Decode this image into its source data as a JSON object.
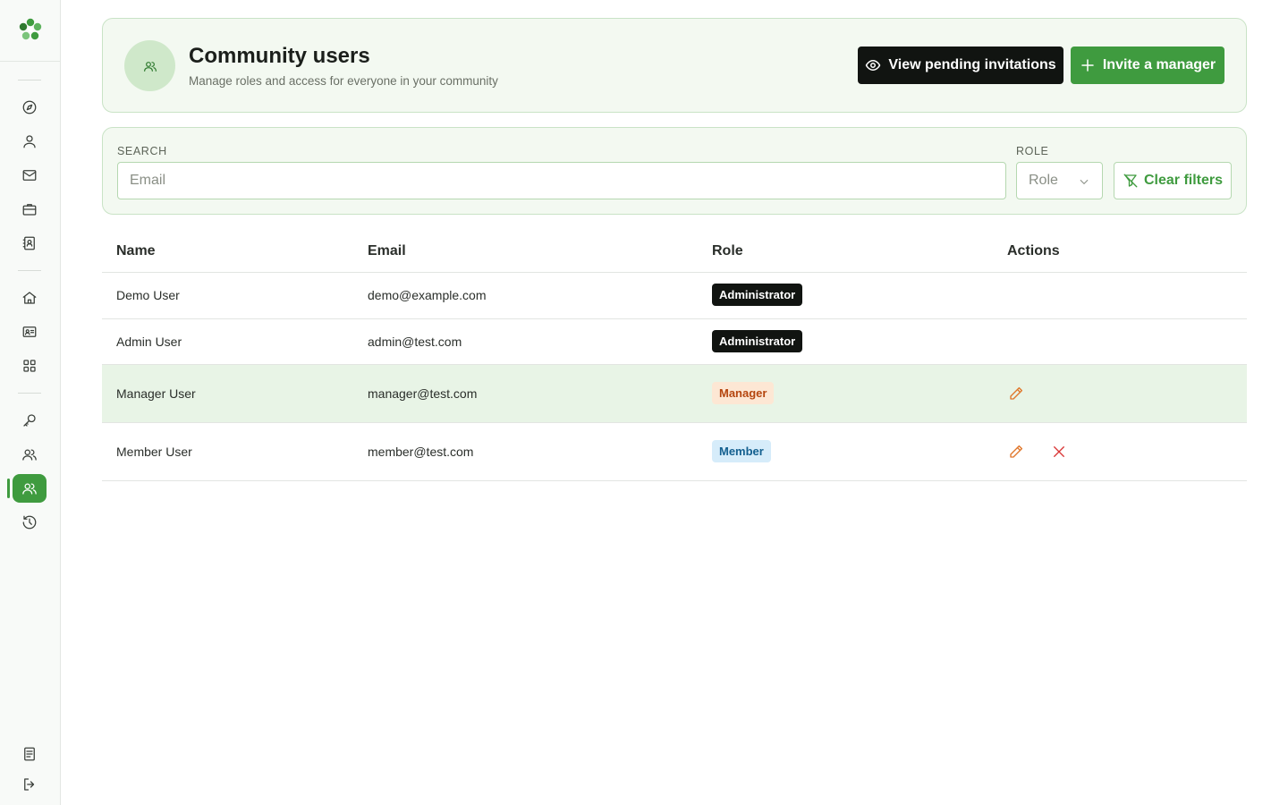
{
  "header": {
    "title": "Community users",
    "subtitle": "Manage roles and access for everyone in your community",
    "view_pending_label": "View pending invitations",
    "invite_label": "Invite a manager"
  },
  "filters": {
    "search_label": "SEARCH",
    "search_placeholder": "Email",
    "search_value": "",
    "role_label": "ROLE",
    "role_value": "Role",
    "clear_label": "Clear filters"
  },
  "table": {
    "columns": [
      "Name",
      "Email",
      "Role",
      "Actions"
    ],
    "rows": [
      {
        "name": "Demo User",
        "email": "demo@example.com",
        "role": "Administrator",
        "role_kind": "admin",
        "can_edit": false,
        "can_delete": false
      },
      {
        "name": "Admin User",
        "email": "admin@test.com",
        "role": "Administrator",
        "role_kind": "admin",
        "can_edit": false,
        "can_delete": false
      },
      {
        "name": "Manager User",
        "email": "manager@test.com",
        "role": "Manager",
        "role_kind": "manager",
        "can_edit": true,
        "can_delete": false
      },
      {
        "name": "Member User",
        "email": "member@test.com",
        "role": "Member",
        "role_kind": "member",
        "can_edit": true,
        "can_delete": true
      }
    ]
  },
  "sidebar": {
    "items": [
      {
        "icon": "compass-icon"
      },
      {
        "icon": "user-icon"
      },
      {
        "icon": "mail-icon"
      },
      {
        "icon": "briefcase-icon"
      },
      {
        "icon": "contact-book-icon"
      },
      {
        "icon": "home-icon"
      },
      {
        "icon": "id-card-icon"
      },
      {
        "icon": "grid-icon"
      },
      {
        "icon": "key-icon"
      },
      {
        "icon": "users-icon"
      },
      {
        "icon": "community-users-icon",
        "active": true
      },
      {
        "icon": "history-icon"
      },
      {
        "icon": "document-icon"
      },
      {
        "icon": "logout-icon"
      }
    ]
  },
  "colors": {
    "accent": "#3f9b3f",
    "dark": "#111411",
    "highlight_row": "#e8f4e6",
    "edit": "#e0762a",
    "delete": "#d93535"
  }
}
